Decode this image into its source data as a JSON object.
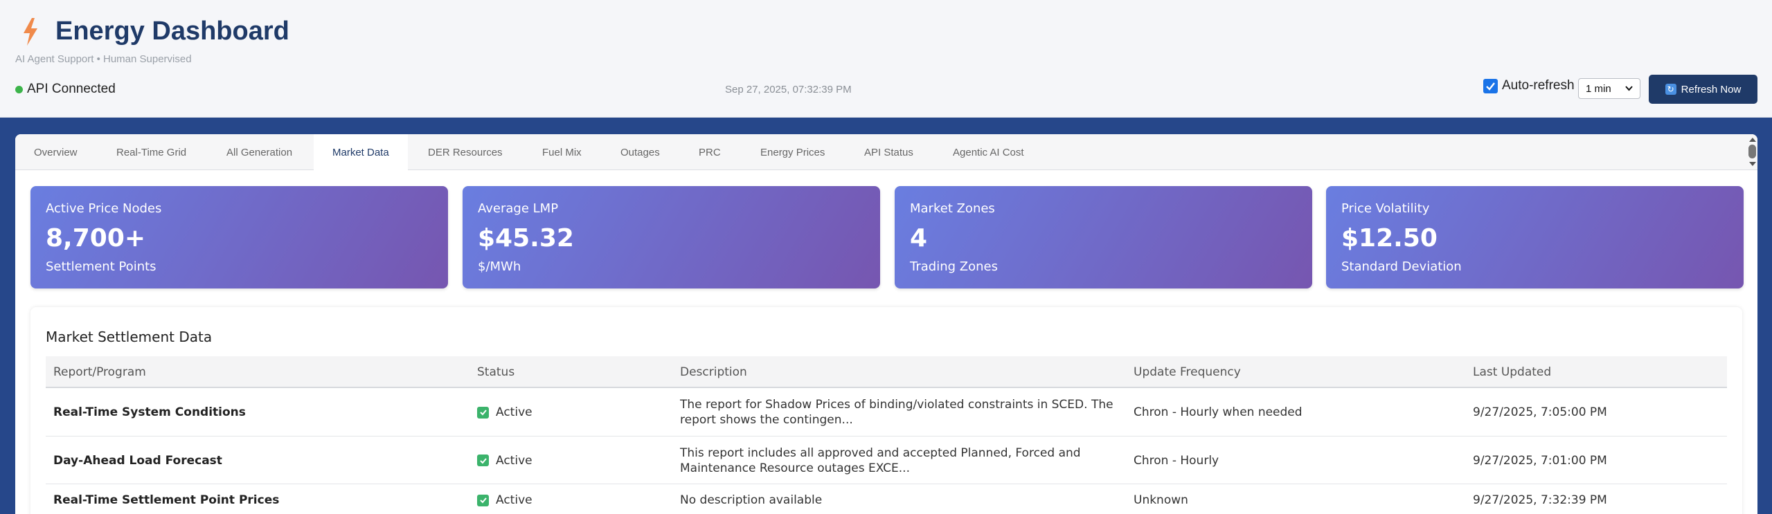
{
  "header": {
    "title": "Energy Dashboard",
    "subtitle": "AI Agent Support • Human Supervised",
    "api_status": "API Connected",
    "timestamp": "Sep 27, 2025, 07:32:39 PM",
    "auto_refresh_label": "Auto-refresh",
    "auto_refresh_checked": true,
    "interval_value": "1 min",
    "refresh_button_label": "Refresh Now"
  },
  "tabs": [
    {
      "label": "Overview"
    },
    {
      "label": "Real-Time Grid"
    },
    {
      "label": "All Generation"
    },
    {
      "label": "Market Data",
      "active": true
    },
    {
      "label": "DER Resources"
    },
    {
      "label": "Fuel Mix"
    },
    {
      "label": "Outages"
    },
    {
      "label": "PRC"
    },
    {
      "label": "Energy Prices"
    },
    {
      "label": "API Status"
    },
    {
      "label": "Agentic AI Cost"
    }
  ],
  "cards": [
    {
      "label": "Active Price Nodes",
      "value": "8,700+",
      "sub": "Settlement Points"
    },
    {
      "label": "Average LMP",
      "value": "$45.32",
      "sub": "$/MWh"
    },
    {
      "label": "Market Zones",
      "value": "4",
      "sub": "Trading Zones"
    },
    {
      "label": "Price Volatility",
      "value": "$12.50",
      "sub": "Standard Deviation"
    }
  ],
  "settlement": {
    "title": "Market Settlement Data",
    "columns": [
      "Report/Program",
      "Status",
      "Description",
      "Update Frequency",
      "Last Updated"
    ],
    "rows": [
      {
        "name": "Real-Time System Conditions",
        "status": "Active",
        "description": "The report for Shadow Prices of binding/violated constraints in SCED. The report shows the contingen...",
        "frequency": "Chron - Hourly when needed",
        "updated": "9/27/2025, 7:05:00 PM"
      },
      {
        "name": "Day-Ahead Load Forecast",
        "status": "Active",
        "description": "This report includes all approved and accepted Planned, Forced and Maintenance Resource outages EXCE...",
        "frequency": "Chron - Hourly",
        "updated": "9/27/2025, 7:01:00 PM"
      },
      {
        "name": "Real-Time Settlement Point Prices",
        "status": "Active",
        "description": "No description available",
        "frequency": "Unknown",
        "updated": "9/27/2025, 7:32:39 PM"
      }
    ]
  },
  "colors": {
    "brand": "#1f3a68",
    "accent_bolt": "#f08a4b",
    "status_ok": "#3cb44b",
    "card_gradient_start": "#6a7ee0",
    "card_gradient_end": "#7656b0"
  },
  "icons": {
    "logo": "lightning-bolt-icon",
    "status": "status-dot-icon",
    "refresh": "refresh-icon",
    "active": "check-icon"
  }
}
